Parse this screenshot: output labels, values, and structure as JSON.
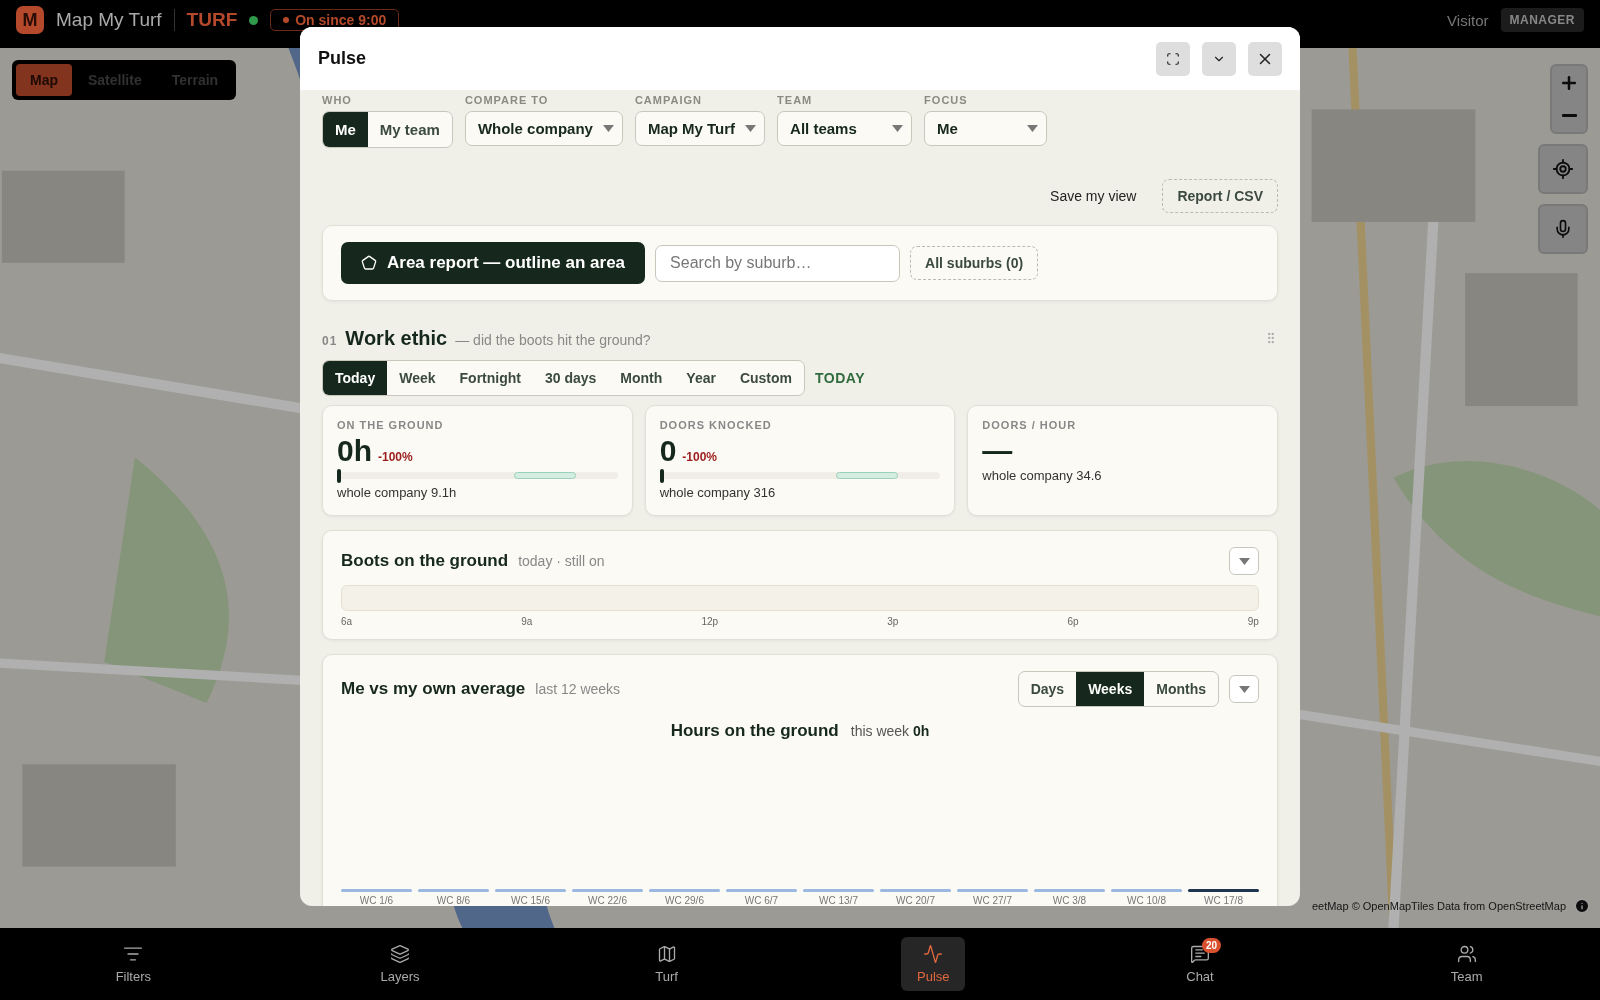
{
  "app": {
    "logo_letter": "M",
    "name": "Map My Turf",
    "mode": "TURF",
    "live": true,
    "shift": "On since 9:00"
  },
  "user": {
    "name": "Visitor",
    "role": "MANAGER"
  },
  "map_types": [
    {
      "label": "Map",
      "selected": true
    },
    {
      "label": "Satellite",
      "selected": false
    },
    {
      "label": "Terrain",
      "selected": false
    }
  ],
  "map_attribution": "eetMap © OpenMapTiles Data from OpenStreetMap",
  "pulse": {
    "title": "Pulse",
    "filters": [
      {
        "kind": "toggle",
        "label": "WHO",
        "options": [
          {
            "label": "Me",
            "selected": true
          },
          {
            "label": "My team",
            "selected": false
          }
        ]
      },
      {
        "kind": "select",
        "label": "COMPARE TO",
        "value": "Whole company"
      },
      {
        "kind": "select",
        "label": "CAMPAIGN",
        "value": "Map My Turf"
      },
      {
        "kind": "select",
        "label": "TEAM",
        "value": "All teams"
      },
      {
        "kind": "select",
        "label": "FOCUS",
        "value": "Me"
      }
    ],
    "save_view": "Save my view",
    "report": "Report / CSV",
    "area": {
      "button": "Area report — outline an area",
      "search_placeholder": "Search by suburb…",
      "suburbs": "All suburbs (0)"
    },
    "section": {
      "number": "01",
      "title": "Work ethic",
      "subtitle": "— did the boots hit the ground?",
      "ranges": [
        {
          "label": "Today",
          "selected": true
        },
        {
          "label": "Week",
          "selected": false
        },
        {
          "label": "Fortnight",
          "selected": false
        },
        {
          "label": "30 days",
          "selected": false
        },
        {
          "label": "Month",
          "selected": false
        },
        {
          "label": "Year",
          "selected": false
        },
        {
          "label": "Custom",
          "selected": false
        }
      ],
      "range_label": "TODAY",
      "stats": [
        {
          "label": "ON THE GROUND",
          "value": "0h",
          "change": "-100%",
          "level": 0,
          "compare": "whole company 9.1h"
        },
        {
          "label": "DOORS KNOCKED",
          "value": "0",
          "change": "-100%",
          "level": 0,
          "compare": "whole company 316"
        },
        {
          "label": "DOORS / HOUR",
          "value": "—",
          "compare": "whole company 34.6"
        }
      ]
    },
    "boots": {
      "title": "Boots on the ground",
      "subtitle": "today · still on",
      "ticks": [
        "6a",
        "9a",
        "12p",
        "3p",
        "6p",
        "9p"
      ]
    },
    "average": {
      "title": "Me vs my own average",
      "subtitle": "last 12 weeks",
      "periods": [
        {
          "label": "Days",
          "selected": false
        },
        {
          "label": "Weeks",
          "selected": true
        },
        {
          "label": "Months",
          "selected": false
        }
      ],
      "chart_title": "Hours on the ground",
      "chart_note": "this week **0h**",
      "weeks": [
        {
          "label": "WC 1/6",
          "selected": false
        },
        {
          "label": "WC 8/6",
          "selected": false
        },
        {
          "label": "WC 15/6",
          "selected": false
        },
        {
          "label": "WC 22/6",
          "selected": false
        },
        {
          "label": "WC 29/6",
          "selected": false
        },
        {
          "label": "WC 6/7",
          "selected": false
        },
        {
          "label": "WC 13/7",
          "selected": false
        },
        {
          "label": "WC 20/7",
          "selected": false
        },
        {
          "label": "WC 27/7",
          "selected": false
        },
        {
          "label": "WC 3/8",
          "selected": false
        },
        {
          "label": "WC 10/8",
          "selected": false
        },
        {
          "label": "WC 17/8",
          "selected": true
        }
      ]
    }
  },
  "nav": [
    {
      "label": "Filters",
      "selected": false
    },
    {
      "label": "Layers",
      "selected": false
    },
    {
      "label": "Turf",
      "selected": false
    },
    {
      "label": "Pulse",
      "selected": true
    },
    {
      "label": "Chat",
      "selected": false,
      "badge": "20"
    },
    {
      "label": "Team",
      "selected": false
    }
  ]
}
